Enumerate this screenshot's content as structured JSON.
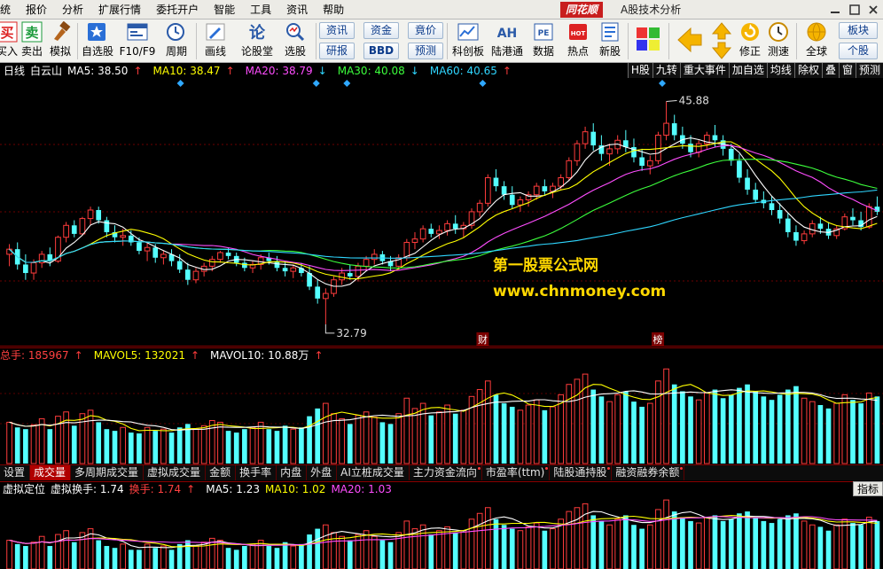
{
  "menu": {
    "items": [
      "统",
      "报价",
      "分析",
      "扩展行情",
      "委托开户",
      "智能",
      "工具",
      "资讯",
      "帮助"
    ]
  },
  "brand": {
    "logo_text": "同花顺",
    "subtitle": "A股技术分析"
  },
  "toolbar": {
    "buttons": [
      {
        "label": "买入",
        "icon": "buy-icon"
      },
      {
        "label": "卖出",
        "icon": "sell-icon"
      },
      {
        "label": "模拟",
        "icon": "simulate-icon"
      },
      {
        "label": "自选股",
        "icon": "watchlist-icon"
      },
      {
        "label": "F10/F9",
        "icon": "f10-icon"
      },
      {
        "label": "周期",
        "icon": "clock-icon"
      },
      {
        "label": "画线",
        "icon": "pencil-icon"
      },
      {
        "label": "论股堂",
        "icon": "forum-icon"
      },
      {
        "label": "选股",
        "icon": "search-stock-icon"
      },
      {
        "label": "科创板",
        "icon": "star-market-icon"
      },
      {
        "label": "陆港通",
        "icon": "ah-icon"
      },
      {
        "label": "数据",
        "icon": "pe-data-icon"
      },
      {
        "label": "热点",
        "icon": "hot-icon"
      },
      {
        "label": "新股",
        "icon": "ipo-icon"
      },
      {
        "label": "修正",
        "icon": "correct-icon"
      },
      {
        "label": "测速",
        "icon": "speed-icon"
      },
      {
        "label": "全球",
        "icon": "globe-icon"
      }
    ],
    "pills": [
      "资讯",
      "资金",
      "竟价",
      "研报",
      "BBD",
      "预测"
    ],
    "icon_labels": {
      "ah": "AH",
      "pe": "PE",
      "hot": "HOT"
    },
    "right_pills": [
      "板块",
      "个股"
    ]
  },
  "main_chart": {
    "period": "日线",
    "stock_name": "白云山",
    "ma": [
      {
        "label": "MA5: 38.50",
        "color": "#ffffff"
      },
      {
        "label": "MA10: 38.47",
        "color": "#ffff00"
      },
      {
        "label": "MA20: 38.79",
        "color": "#ff4dff"
      },
      {
        "label": "MA30: 40.08",
        "color": "#3cff3c"
      },
      {
        "label": "MA60: 40.65",
        "color": "#2fd6ff"
      }
    ],
    "ma_arrows": [
      "up",
      "up",
      "down",
      "down",
      "up"
    ],
    "right_tabs": [
      "H股",
      "九转",
      "重大事件",
      "加自选",
      "均线",
      "除权",
      "叠",
      "窗",
      "预测"
    ],
    "high_label": "45.88",
    "low_label": "32.79",
    "event_markers": [
      "财",
      "榜"
    ],
    "watermark_cn": "第一股票公式网",
    "watermark_url": "www.chnmoney.com"
  },
  "volume_chart": {
    "legend": [
      {
        "label": "总手: 185967",
        "color": "#ff4040"
      },
      {
        "label": "MAVOL5: 132021",
        "color": "#ffff00"
      },
      {
        "label": "MAVOL10: 10.88万",
        "color": "#ffffff"
      }
    ]
  },
  "tabs": [
    {
      "label": "设置",
      "active": false,
      "hot": false
    },
    {
      "label": "成交量",
      "active": true,
      "hot": false
    },
    {
      "label": "多周期成交量",
      "active": false,
      "hot": false
    },
    {
      "label": "虚拟成交量",
      "active": false,
      "hot": false
    },
    {
      "label": "金额",
      "active": false,
      "hot": false
    },
    {
      "label": "换手率",
      "active": false,
      "hot": false
    },
    {
      "label": "内盘",
      "active": false,
      "hot": false
    },
    {
      "label": "外盘",
      "active": false,
      "hot": false
    },
    {
      "label": "AI立桩成交量",
      "active": false,
      "hot": false
    },
    {
      "label": "主力资金流向",
      "active": false,
      "hot": true
    },
    {
      "label": "市盈率(ttm)",
      "active": false,
      "hot": true
    },
    {
      "label": "陆股通持股",
      "active": false,
      "hot": true
    },
    {
      "label": "融资融券余额",
      "active": false,
      "hot": true
    }
  ],
  "indicator_chart": {
    "legend": [
      {
        "label": "虚拟定位",
        "color": "#ffffff"
      },
      {
        "label": "虚拟换手: 1.74",
        "color": "#ffffff"
      },
      {
        "label": "换手: 1.74",
        "color": "#ff4040"
      },
      {
        "label": "MA5: 1.23",
        "color": "#ffffff"
      },
      {
        "label": "MA10: 1.02",
        "color": "#ffff00"
      },
      {
        "label": "MA20: 1.03",
        "color": "#ff4dff"
      }
    ],
    "right_button": "指标"
  },
  "chart_data": {
    "type": "candlestick",
    "price_range": [
      32,
      47
    ],
    "candles": [
      [
        36.9,
        37.5,
        36.2,
        37.2
      ],
      [
        37.2,
        37.6,
        36.0,
        36.3
      ],
      [
        36.3,
        36.9,
        35.4,
        35.8
      ],
      [
        35.8,
        36.6,
        35.4,
        36.4
      ],
      [
        36.4,
        37.1,
        36.1,
        36.9
      ],
      [
        36.9,
        37.3,
        36.2,
        36.5
      ],
      [
        36.5,
        38.0,
        36.4,
        37.9
      ],
      [
        37.9,
        38.8,
        37.6,
        38.6
      ],
      [
        38.6,
        38.9,
        37.9,
        38.1
      ],
      [
        38.1,
        39.1,
        38.0,
        39.0
      ],
      [
        39.0,
        39.7,
        38.6,
        39.5
      ],
      [
        39.5,
        39.7,
        38.7,
        38.9
      ],
      [
        38.9,
        39.1,
        37.9,
        38.2
      ],
      [
        38.2,
        38.6,
        37.6,
        37.9
      ],
      [
        37.9,
        38.4,
        37.4,
        38.0
      ],
      [
        38.0,
        38.3,
        37.4,
        37.6
      ],
      [
        37.6,
        37.9,
        36.9,
        37.1
      ],
      [
        37.1,
        37.6,
        36.5,
        37.3
      ],
      [
        37.3,
        37.5,
        36.4,
        36.7
      ],
      [
        36.7,
        37.1,
        36.3,
        36.9
      ],
      [
        36.9,
        37.2,
        36.2,
        36.5
      ],
      [
        36.5,
        36.9,
        35.8,
        36.0
      ],
      [
        36.0,
        36.4,
        35.1,
        35.4
      ],
      [
        35.4,
        36.1,
        35.2,
        35.9
      ],
      [
        35.9,
        36.4,
        35.6,
        36.2
      ],
      [
        36.2,
        36.8,
        35.9,
        36.6
      ],
      [
        36.6,
        37.1,
        36.4,
        37.0
      ],
      [
        37.0,
        37.3,
        36.6,
        36.8
      ],
      [
        36.8,
        37.0,
        36.2,
        36.4
      ],
      [
        36.4,
        36.7,
        35.9,
        36.1
      ],
      [
        36.1,
        36.5,
        35.8,
        36.3
      ],
      [
        36.3,
        36.9,
        36.0,
        36.7
      ],
      [
        36.7,
        37.0,
        36.3,
        36.5
      ],
      [
        36.5,
        36.8,
        35.9,
        36.1
      ],
      [
        36.1,
        36.5,
        35.6,
        35.9
      ],
      [
        35.9,
        36.3,
        35.5,
        36.1
      ],
      [
        36.1,
        36.4,
        35.6,
        35.8
      ],
      [
        35.8,
        36.2,
        34.8,
        35.0
      ],
      [
        35.0,
        35.4,
        34.0,
        34.3
      ],
      [
        34.3,
        34.9,
        32.79,
        34.6
      ],
      [
        34.6,
        35.6,
        34.4,
        35.4
      ],
      [
        35.4,
        36.1,
        35.1,
        35.8
      ],
      [
        35.8,
        36.3,
        35.4,
        35.6
      ],
      [
        35.6,
        36.4,
        35.3,
        36.2
      ],
      [
        36.2,
        36.8,
        35.9,
        36.6
      ],
      [
        36.6,
        37.2,
        36.3,
        36.9
      ],
      [
        36.9,
        37.1,
        36.3,
        36.5
      ],
      [
        36.5,
        36.8,
        35.9,
        36.2
      ],
      [
        36.2,
        36.9,
        36.0,
        36.7
      ],
      [
        36.7,
        37.8,
        36.5,
        37.6
      ],
      [
        37.6,
        38.2,
        37.2,
        37.8
      ],
      [
        37.8,
        38.6,
        37.6,
        38.4
      ],
      [
        38.4,
        38.7,
        37.9,
        38.1
      ],
      [
        38.1,
        38.6,
        37.8,
        38.3
      ],
      [
        38.3,
        38.9,
        38.0,
        38.7
      ],
      [
        38.7,
        39.2,
        38.1,
        38.4
      ],
      [
        38.4,
        38.8,
        37.9,
        38.6
      ],
      [
        38.6,
        39.6,
        38.4,
        39.4
      ],
      [
        39.4,
        40.1,
        39.1,
        39.9
      ],
      [
        39.9,
        41.6,
        39.7,
        41.4
      ],
      [
        41.4,
        41.9,
        40.6,
        40.9
      ],
      [
        40.9,
        41.2,
        40.1,
        40.4
      ],
      [
        40.4,
        40.9,
        39.6,
        39.8
      ],
      [
        39.8,
        40.3,
        39.4,
        40.1
      ],
      [
        40.1,
        40.6,
        39.7,
        40.4
      ],
      [
        40.4,
        41.1,
        40.1,
        40.9
      ],
      [
        40.9,
        41.3,
        40.4,
        40.6
      ],
      [
        40.6,
        41.1,
        40.2,
        40.9
      ],
      [
        40.9,
        41.6,
        40.7,
        41.4
      ],
      [
        41.4,
        42.6,
        41.2,
        42.4
      ],
      [
        42.4,
        43.6,
        42.1,
        43.4
      ],
      [
        43.4,
        44.4,
        43.1,
        44.1
      ],
      [
        44.1,
        44.6,
        43.0,
        43.3
      ],
      [
        43.3,
        43.9,
        42.4,
        42.8
      ],
      [
        42.8,
        43.4,
        42.1,
        43.1
      ],
      [
        43.1,
        43.9,
        42.8,
        43.6
      ],
      [
        43.6,
        44.2,
        42.9,
        43.2
      ],
      [
        43.2,
        43.7,
        42.3,
        42.6
      ],
      [
        42.6,
        43.1,
        41.8,
        42.1
      ],
      [
        42.1,
        42.7,
        41.6,
        42.4
      ],
      [
        42.4,
        44.1,
        42.2,
        43.9
      ],
      [
        43.9,
        45.88,
        43.6,
        44.6
      ],
      [
        44.6,
        45.1,
        43.6,
        43.9
      ],
      [
        43.9,
        44.4,
        43.1,
        43.4
      ],
      [
        43.4,
        43.9,
        42.6,
        42.9
      ],
      [
        42.9,
        43.6,
        42.6,
        43.4
      ],
      [
        43.4,
        44.1,
        43.1,
        43.9
      ],
      [
        43.9,
        44.5,
        43.2,
        43.6
      ],
      [
        43.6,
        43.9,
        42.7,
        43.1
      ],
      [
        43.1,
        43.4,
        42.1,
        42.4
      ],
      [
        42.4,
        42.8,
        41.1,
        41.4
      ],
      [
        41.4,
        41.9,
        40.4,
        40.7
      ],
      [
        40.7,
        41.1,
        39.9,
        40.1
      ],
      [
        40.1,
        40.6,
        39.6,
        39.9
      ],
      [
        39.9,
        40.3,
        39.2,
        39.5
      ],
      [
        39.5,
        39.9,
        38.7,
        39.0
      ],
      [
        39.0,
        39.3,
        37.9,
        38.2
      ],
      [
        38.2,
        38.6,
        37.4,
        37.7
      ],
      [
        37.7,
        38.3,
        37.5,
        38.1
      ],
      [
        38.1,
        38.9,
        37.9,
        38.7
      ],
      [
        38.7,
        39.1,
        38.1,
        38.4
      ],
      [
        38.4,
        38.8,
        37.8,
        38.0
      ],
      [
        38.0,
        38.6,
        37.8,
        38.4
      ],
      [
        38.4,
        39.3,
        38.3,
        39.1
      ],
      [
        39.1,
        39.6,
        38.6,
        38.9
      ],
      [
        38.9,
        39.4,
        38.3,
        38.5
      ],
      [
        38.5,
        39.9,
        38.4,
        39.7
      ],
      [
        39.7,
        40.3,
        39.2,
        39.4
      ]
    ],
    "volume": [
      48,
      42,
      40,
      45,
      52,
      40,
      55,
      60,
      44,
      58,
      62,
      48,
      40,
      38,
      42,
      36,
      35,
      42,
      38,
      40,
      36,
      42,
      46,
      40,
      44,
      50,
      48,
      38,
      36,
      40,
      42,
      48,
      40,
      38,
      44,
      40,
      42,
      55,
      64,
      70,
      58,
      52,
      46,
      56,
      60,
      54,
      48,
      46,
      58,
      76,
      64,
      70,
      56,
      60,
      68,
      58,
      62,
      78,
      86,
      96,
      80,
      70,
      66,
      62,
      68,
      74,
      62,
      66,
      80,
      92,
      98,
      104,
      86,
      78,
      72,
      80,
      84,
      72,
      66,
      70,
      96,
      110,
      92,
      84,
      78,
      74,
      82,
      86,
      76,
      80,
      88,
      92,
      84,
      78,
      74,
      80,
      86,
      90,
      76,
      72,
      68,
      64,
      70,
      80,
      74,
      70,
      82,
      78
    ],
    "turnover": [
      30,
      26,
      24,
      28,
      34,
      24,
      36,
      40,
      28,
      38,
      42,
      30,
      24,
      22,
      26,
      20,
      20,
      26,
      22,
      24,
      20,
      26,
      30,
      24,
      28,
      32,
      30,
      22,
      20,
      24,
      26,
      30,
      24,
      22,
      28,
      24,
      26,
      36,
      42,
      46,
      38,
      34,
      30,
      36,
      40,
      34,
      30,
      28,
      38,
      50,
      42,
      46,
      36,
      40,
      44,
      38,
      40,
      52,
      58,
      64,
      52,
      46,
      42,
      40,
      44,
      48,
      40,
      42,
      52,
      60,
      64,
      68,
      56,
      50,
      46,
      52,
      56,
      46,
      42,
      46,
      62,
      72,
      60,
      54,
      50,
      48,
      54,
      56,
      50,
      52,
      58,
      60,
      54,
      50,
      48,
      52,
      56,
      58,
      50,
      46,
      44,
      40,
      46,
      52,
      48,
      46,
      54,
      50
    ]
  }
}
